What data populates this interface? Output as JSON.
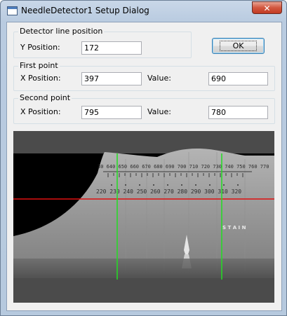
{
  "window": {
    "title": "NeedleDetector1 Setup Dialog",
    "close_glyph": "✕"
  },
  "detector_line": {
    "group_label": "Detector line position",
    "y_label": "Y Position:",
    "y_value": "172"
  },
  "ok_button": {
    "label": "OK"
  },
  "first_point": {
    "group_label": "First point",
    "x_label": "X Position:",
    "x_value": "397",
    "value_label": "Value:",
    "value": "690"
  },
  "second_point": {
    "group_label": "Second point",
    "x_label": "X Position:",
    "x_value": "795",
    "value_label": "Value:",
    "value": "780"
  },
  "preview": {
    "scale_numbers_upper": "30  640  650  660  670  680  690  700  710  720  730  740  750  760  770",
    "scale_numbers_lower": "220 230 240 250 260 270 280 290 300 310 320",
    "scale_letters": "S T A I N",
    "colors": {
      "detector_line": "#e01010",
      "point_markers": "#22dd22"
    }
  }
}
